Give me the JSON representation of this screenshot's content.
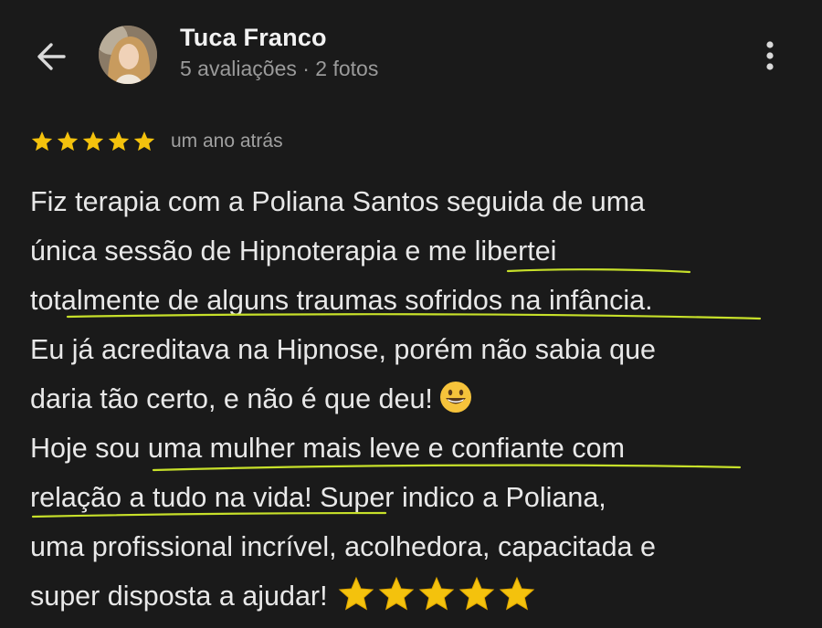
{
  "reviewer": {
    "name": "Tuca Franco",
    "meta": "5 avaliações · 2 fotos"
  },
  "review": {
    "rating": 5,
    "time": "um ano atrás",
    "lines": [
      "Fiz terapia com a Poliana Santos seguida de uma",
      "única sessão de Hipnoterapia e me libertei",
      "totalmente de alguns traumas sofridos na infância.",
      "Eu já acreditava na Hipnose, porém não sabia que",
      "daria tão certo, e não é que deu!",
      "Hoje sou uma mulher mais leve e confiante com",
      "relação a tudo na vida! Super indico a Poliana,",
      "uma profissional incrível, acolhedora, capacitada e",
      "super disposta a ajudar!"
    ]
  },
  "icons": {
    "back": "arrow-left-icon",
    "more": "more-vertical-icon",
    "star": "star-icon",
    "emoji": "grinning-face-icon"
  },
  "colors": {
    "background": "#1a1a1a",
    "star": "#f4c20d",
    "underline": "#c7e02a"
  }
}
